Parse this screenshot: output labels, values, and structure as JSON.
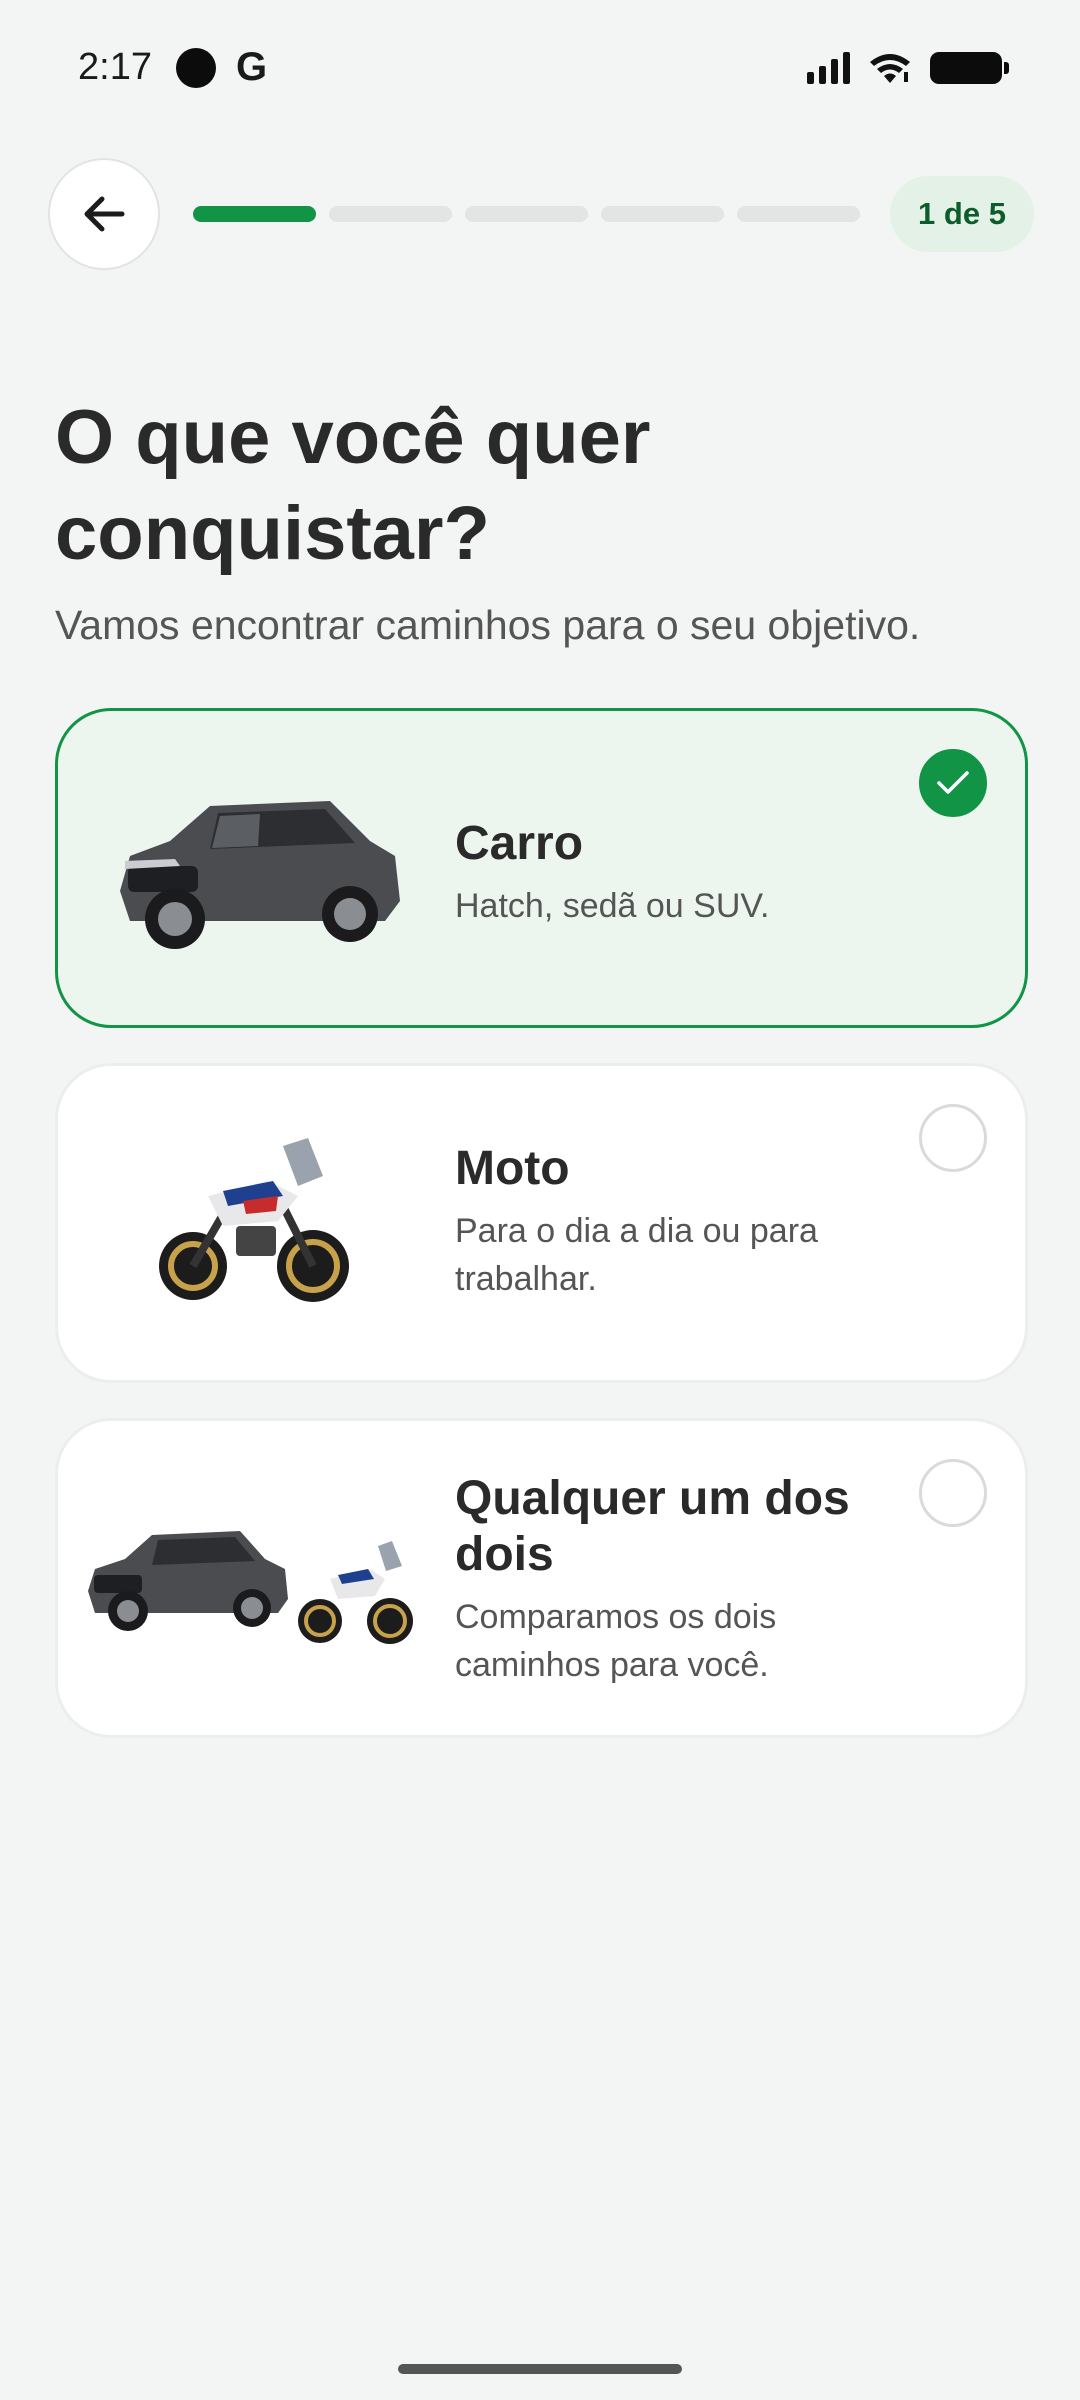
{
  "status_bar": {
    "time": "2:17",
    "g_label": "G",
    "icons": [
      "signal-icon",
      "wifi-icon",
      "battery-icon"
    ]
  },
  "nav": {
    "back_icon": "arrow-left-icon",
    "progress": {
      "current_step": 1,
      "total_steps": 5
    },
    "step_label": "1 de 5"
  },
  "header": {
    "title_line1": "O que você quer",
    "title_line2": "conquistar?",
    "subtitle": "Vamos encontrar caminhos para o seu objetivo."
  },
  "options": [
    {
      "title": "Carro",
      "description": "Hatch, sedã ou SUV.",
      "selected": true,
      "image": "suv-car-image"
    },
    {
      "title": "Moto",
      "description_line1": "Para o dia a dia ou para",
      "description_line2": "trabalhar.",
      "selected": false,
      "image": "adventure-motorcycle-image"
    },
    {
      "title_line1": "Qualquer um dos",
      "title_line2": "dois",
      "description_line1": "Comparamos os dois",
      "description_line2": "caminhos para você.",
      "selected": false,
      "image": "car-and-motorcycle-image"
    }
  ],
  "colors": {
    "accent": "#129447",
    "selected_bg": "#ecf6ef",
    "badge_bg": "#e3f1e7",
    "badge_text": "#0d5c2c",
    "background": "#f3f5f4"
  }
}
